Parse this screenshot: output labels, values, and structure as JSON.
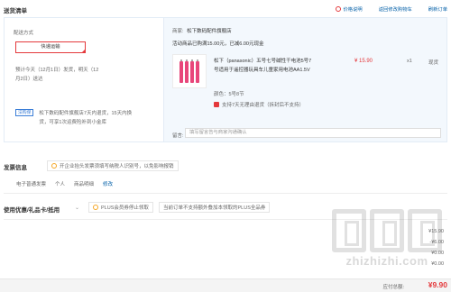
{
  "page": {
    "section_list_title": "送货清单",
    "top_links": [
      "价格说明",
      "返回修改购物车",
      "刷新订单"
    ]
  },
  "delivery": {
    "label": "配送方式",
    "method_button": "快递运输",
    "eta_line1": "预计今天（12月1日）发货，明天（12",
    "eta_line2": "月2日）送达",
    "tip_badge": "法购保",
    "tip_text_line1": "松下数码配件旗舰店7天内退货，15天内换",
    "tip_text_line2": "货，可享1次运费险补到小金库"
  },
  "shop": {
    "seller_key": "商家:",
    "seller_name": "松下数码配件旗舰店",
    "promo_text": "活动商品已购满15.00元，已减6.00元现金"
  },
  "goods": {
    "name_line1": "松下（panasonic）五号七号碱性干电池5号7",
    "name_line2": "号适用于遥控器玩具车儿童家用电池AA1.5V",
    "price": "¥ 15.90",
    "qty": "x1",
    "stock": "现货",
    "color": "颜色：5号8节",
    "return_policy": "支持7天无理由退货（拆封后不支持）"
  },
  "remark": {
    "label": "留言:",
    "placeholder": "填写留言告与商家沟通确认"
  },
  "invoice": {
    "title": "发票信息",
    "tip": "开企业抬头发票须填写纳税人识别号，以免影响报销",
    "type": "电子普通发票",
    "holder": "个人",
    "detail": "商品明细",
    "edit": "修改"
  },
  "discount": {
    "title": "使用优惠/礼品卡/抵用",
    "chevron": "⌄",
    "plus_tip": "PLUS会员券停止领取",
    "plus_note": "当前订单不支持额外叠加本领取的PLUS全品券"
  },
  "summary": {
    "row1": "¥15.90",
    "row2": "-¥6.00",
    "row3": "¥0.00",
    "row4": "¥0.00",
    "pay_label": "应付总额:",
    "pay_total": "¥9.90"
  },
  "watermark": {
    "text": "zhizhizhi.com"
  },
  "colors": {
    "accent": "#e4393c",
    "link": "#005ea7",
    "panel_bg": "#f3f8fd"
  }
}
